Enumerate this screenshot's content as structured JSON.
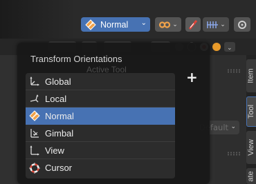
{
  "header": {
    "transform_orientation": {
      "label": "Normal",
      "icon": "normal-orientation-icon",
      "accent": "#4772b3"
    },
    "buttons": [
      {
        "icon": "pivot-infinity-icon"
      },
      {
        "icon": "snap-icon"
      },
      {
        "icon": "proportional-edit-icon"
      }
    ]
  },
  "popup": {
    "title": "Transform Orientations",
    "ghost_text": "Active Tool",
    "add_label": "+",
    "items": [
      {
        "label": "Global",
        "icon": "global-axes-icon",
        "selected": false
      },
      {
        "label": "Local",
        "icon": "local-axes-icon",
        "selected": false
      },
      {
        "label": "Normal",
        "icon": "normal-orientation-icon",
        "selected": true
      },
      {
        "label": "Gimbal",
        "icon": "gimbal-icon",
        "selected": false
      },
      {
        "label": "View",
        "icon": "view-axes-icon",
        "selected": false
      },
      {
        "label": "Cursor",
        "icon": "cursor-icon",
        "selected": false
      }
    ]
  },
  "sidebar": {
    "tabs": [
      {
        "label": "Item",
        "active": false
      },
      {
        "label": "Tool",
        "active": true
      },
      {
        "label": "View",
        "active": false
      },
      {
        "label": "ate",
        "active": false
      }
    ],
    "dropdown_value": "Default"
  },
  "colors": {
    "selected": "#4772b3",
    "menu_bg": "#2c2c2c",
    "popup_bg": "#181818"
  }
}
